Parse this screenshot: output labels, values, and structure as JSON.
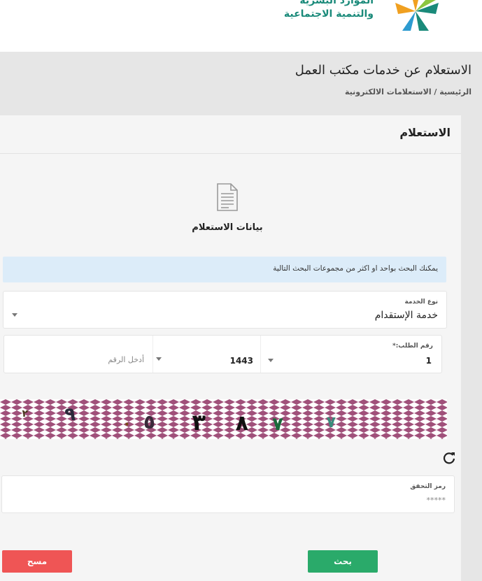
{
  "header": {
    "ministry_line1": "الموارد البشرية",
    "ministry_line2": "والتنمية الاجتماعية"
  },
  "page": {
    "title": "الاستعلام عن خدمات مكتب العمل",
    "breadcrumb": "الرئيسية / الاستعلامات الالكترونية"
  },
  "card": {
    "title": "الاستعلام",
    "step_label": "بيانات الاستعلام",
    "info_text": "يمكنك البحث بواحد او اكثر من مجموعات البحث التالية"
  },
  "form": {
    "service_type": {
      "label": "نوع الخدمة",
      "value": "خدمة الإستقدام"
    },
    "request_number": {
      "label": "رقم الطلب:*",
      "part1": "1",
      "year": "1443",
      "number_placeholder": "أدخل الرقم"
    },
    "captcha_code": {
      "label": "رمز التحقق",
      "placeholder": "*****"
    }
  },
  "buttons": {
    "search": "بحث",
    "clear": "مسح"
  },
  "colors": {
    "brand_teal": "#1a8a7a",
    "search_green": "#2aaa6a",
    "clear_red": "#ef5555",
    "info_bg": "#dcecf9"
  },
  "icons": [
    "ministry-logo-icon",
    "document-icon",
    "refresh-icon",
    "dropdown-caret-icon"
  ]
}
